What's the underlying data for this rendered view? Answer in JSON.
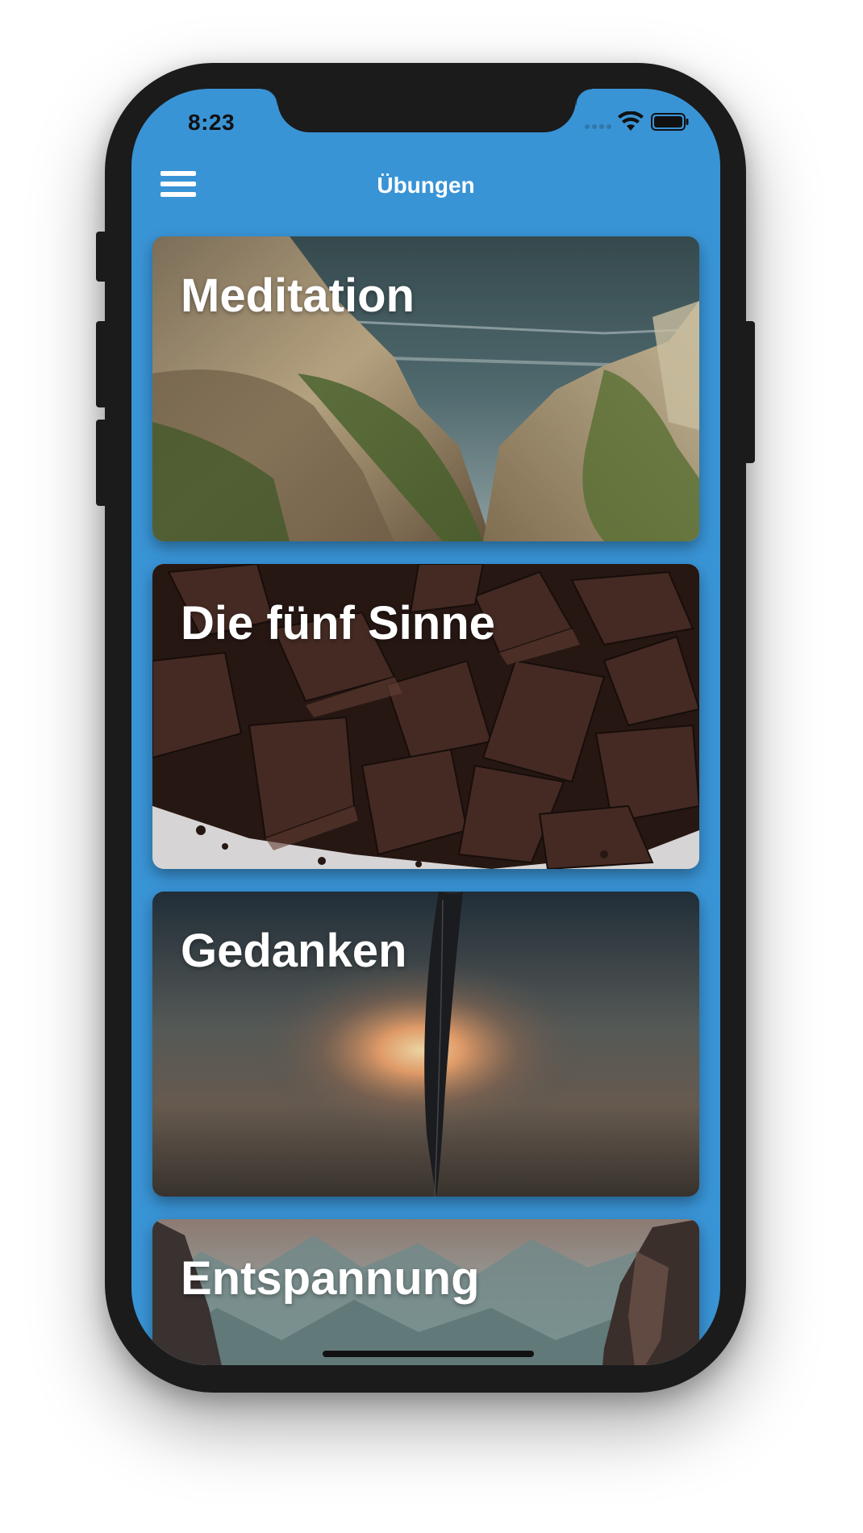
{
  "status_bar": {
    "time": "8:23"
  },
  "nav": {
    "title": "Übungen",
    "menu_icon": "hamburger-menu-icon"
  },
  "colors": {
    "accent": "#3994d6",
    "phone_frame": "#1b1b1c",
    "text": "#ffffff"
  },
  "cards": [
    {
      "title": "Meditation",
      "image": "coastal-cliffs-ocean"
    },
    {
      "title": "Die fünf Sinne",
      "image": "dark-chocolate-pieces"
    },
    {
      "title": "Gedanken",
      "image": "feather-sunset-blur"
    },
    {
      "title": "Entspannung",
      "image": "misty-mountains"
    }
  ]
}
